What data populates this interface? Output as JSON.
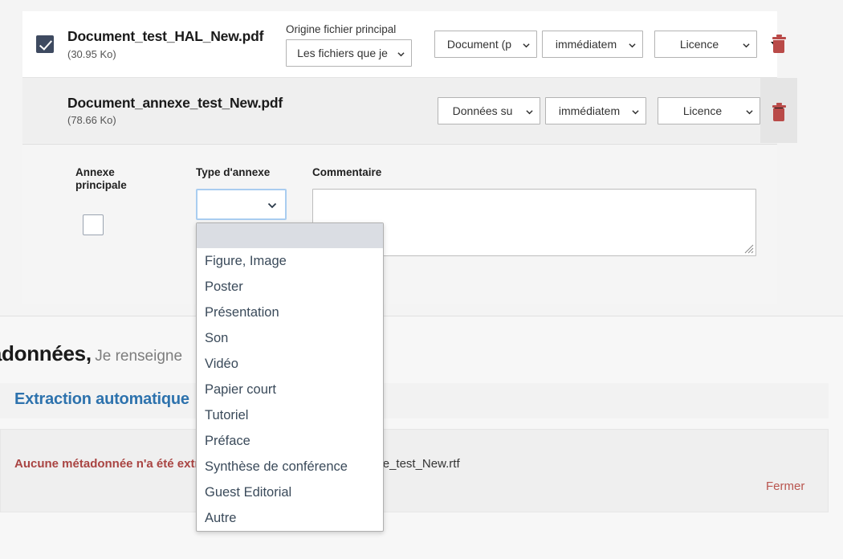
{
  "files": [
    {
      "name": "Document_test_HAL_New.pdf",
      "size": "(30.95 Ko)",
      "checked": true,
      "origin_label": "Origine fichier principal",
      "origin_value": "Les fichiers que je",
      "type_value": "Document (p",
      "visibility_value": "immédiatem",
      "licence_value": "Licence"
    },
    {
      "name": "Document_annexe_test_New.pdf",
      "size": "(78.66 Ko)",
      "checked": false,
      "origin_label": "",
      "origin_value": "",
      "type_value": "Données su",
      "visibility_value": "immédiatem",
      "licence_value": "Licence"
    }
  ],
  "annexe_form": {
    "annexe_principale_label_line1": "Annexe",
    "annexe_principale_label_line2": "principale",
    "type_label": "Type d'annexe",
    "type_value": "",
    "comment_label": "Commentaire",
    "comment_value": ""
  },
  "dropdown": {
    "open": true,
    "options": [
      "",
      "Figure, Image",
      "Poster",
      "Présentation",
      "Son",
      "Vidéo",
      "Papier court",
      "Tutoriel",
      "Préface",
      "Synthèse de conférence",
      "Guest Editorial",
      "Autre"
    ],
    "selected_index": 0
  },
  "lower": {
    "heading_strong": "Métadonnées,",
    "heading_light": "Je renseigne",
    "extraction_title": "Extraction automatique",
    "alert_red": "Aucune métadonnée n'a été extraite du fichier :",
    "alert_file": "Document_annexe_test_New.rtf",
    "fermer_label": "Fermer"
  },
  "colors": {
    "accent_blue": "#2d72ad",
    "alert_red": "#a94442",
    "link_red": "#b9554f",
    "checkbox_fill": "#3e4a60",
    "trash_red": "#b94a48",
    "focus_ring": "#a9cdf0",
    "highlight_row": "#dadde3"
  }
}
